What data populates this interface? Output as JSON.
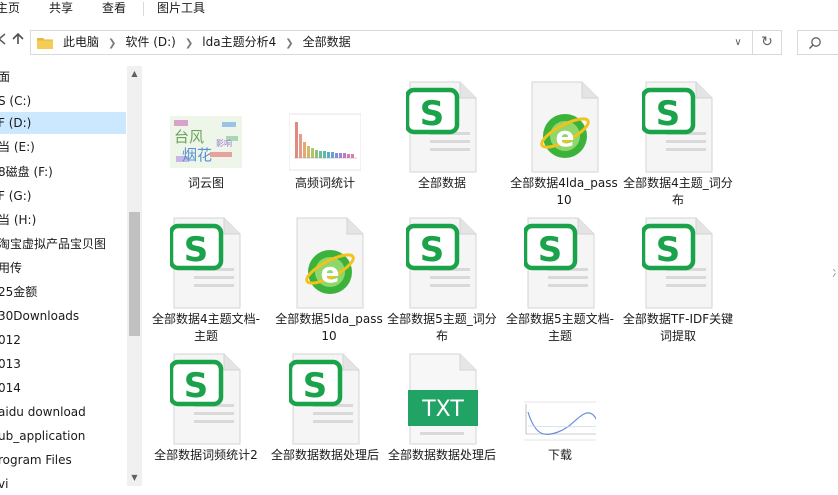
{
  "ribbon": {
    "tabs": [
      "主页",
      "共享",
      "查看",
      "图片工具"
    ]
  },
  "toolbar": {
    "back_icon": "back-arrow-icon",
    "up_icon": "up-arrow-icon",
    "breadcrumb": [
      "此电脑",
      "软件 (D:)",
      "lda主题分析4",
      "全部数据"
    ],
    "dropdown_icon": "chevron-down-icon",
    "refresh_icon": "refresh-icon",
    "search_icon": "search-icon"
  },
  "sidebar": {
    "items": [
      {
        "label": "面"
      },
      {
        "label": "S (C:)"
      },
      {
        "label": "F (D:)"
      },
      {
        "label": "当 (E:)"
      },
      {
        "label": "8磁盘 (F:)"
      },
      {
        "label": "F (G:)"
      },
      {
        "label": "当 (H:)"
      },
      {
        "label": "淘宝虚拟产品宝贝图"
      },
      {
        "label": "用传"
      },
      {
        "label": "25金额"
      },
      {
        "label": "30Downloads"
      },
      {
        "label": "012"
      },
      {
        "label": "013"
      },
      {
        "label": "014"
      },
      {
        "label": "aidu download"
      },
      {
        "label": "ub_application"
      },
      {
        "label": "rogram Files"
      },
      {
        "label": "vi"
      }
    ]
  },
  "files": [
    {
      "label": "词云图",
      "type": "wordcloud-image"
    },
    {
      "label": "高频词统计",
      "type": "chart-image"
    },
    {
      "label": "全部数据",
      "type": "wps-sheet"
    },
    {
      "label": "全部数据4lda_pass10",
      "type": "ie-html"
    },
    {
      "label": "全部数据4主题_词分布",
      "type": "wps-sheet"
    },
    {
      "label": "全部数据4主题文档-主题",
      "type": "wps-sheet"
    },
    {
      "label": "全部数据5lda_pass10",
      "type": "ie-html"
    },
    {
      "label": "全部数据5主题_词分布",
      "type": "wps-sheet"
    },
    {
      "label": "全部数据5主题文档-主题",
      "type": "wps-sheet"
    },
    {
      "label": "全部数据TF-IDF关键词提取",
      "type": "wps-sheet"
    },
    {
      "label": "全部数据词频统计2",
      "type": "wps-sheet"
    },
    {
      "label": "全部数据数据处理后",
      "type": "wps-sheet"
    },
    {
      "label": "全部数据数据处理后",
      "type": "txt"
    },
    {
      "label": "下载",
      "type": "chart-image"
    }
  ],
  "icon_texts": {
    "wps": "S",
    "txt": "TXT",
    "ie": "e",
    "wordcloud": [
      "台风",
      "烟花",
      "影响"
    ]
  },
  "colors": {
    "wps_green": "#1aa34a",
    "ie_green": "#2aa52a",
    "txt_green": "#21a366",
    "selected": "#cce8ff"
  },
  "side_edge_text": "冫"
}
